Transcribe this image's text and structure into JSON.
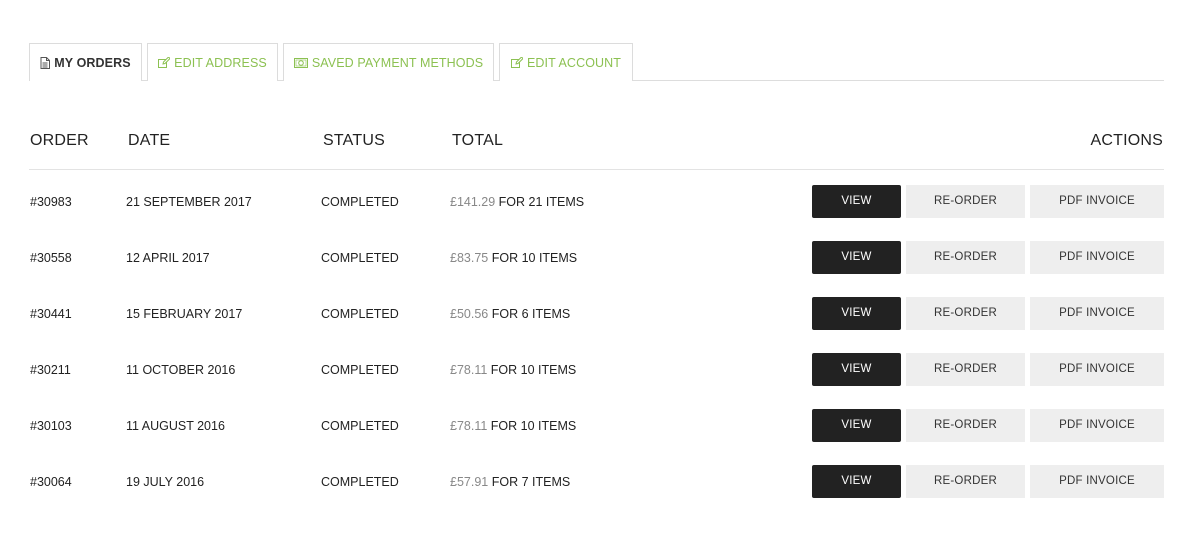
{
  "tabs": [
    {
      "label": "MY ORDERS",
      "icon": "document-icon",
      "active": true
    },
    {
      "label": "EDIT ADDRESS",
      "icon": "edit-icon",
      "active": false
    },
    {
      "label": "SAVED PAYMENT METHODS",
      "icon": "money-icon",
      "active": false
    },
    {
      "label": "EDIT ACCOUNT",
      "icon": "edit-icon",
      "active": false
    }
  ],
  "colors": {
    "accent": "#8cc152",
    "view_button": "#222222",
    "secondary_button": "#eeeeee"
  },
  "table": {
    "headers": {
      "order": "ORDER",
      "date": "DATE",
      "status": "STATUS",
      "total": "TOTAL",
      "actions": "ACTIONS"
    },
    "rows": [
      {
        "order": "#30983",
        "date": "21 SEPTEMBER 2017",
        "status": "COMPLETED",
        "price": "£141.29",
        "items": "FOR 21 ITEMS"
      },
      {
        "order": "#30558",
        "date": "12 APRIL 2017",
        "status": "COMPLETED",
        "price": "£83.75",
        "items": "FOR 10 ITEMS"
      },
      {
        "order": "#30441",
        "date": "15 FEBRUARY 2017",
        "status": "COMPLETED",
        "price": "£50.56",
        "items": "FOR 6 ITEMS"
      },
      {
        "order": "#30211",
        "date": "11 OCTOBER 2016",
        "status": "COMPLETED",
        "price": "£78.11",
        "items": "FOR 10 ITEMS"
      },
      {
        "order": "#30103",
        "date": "11 AUGUST 2016",
        "status": "COMPLETED",
        "price": "£78.11",
        "items": "FOR 10 ITEMS"
      },
      {
        "order": "#30064",
        "date": "19 JULY 2016",
        "status": "COMPLETED",
        "price": "£57.91",
        "items": "FOR 7 ITEMS"
      }
    ],
    "actions": {
      "view": "VIEW",
      "reorder": "RE-ORDER",
      "pdf": "PDF INVOICE"
    }
  }
}
